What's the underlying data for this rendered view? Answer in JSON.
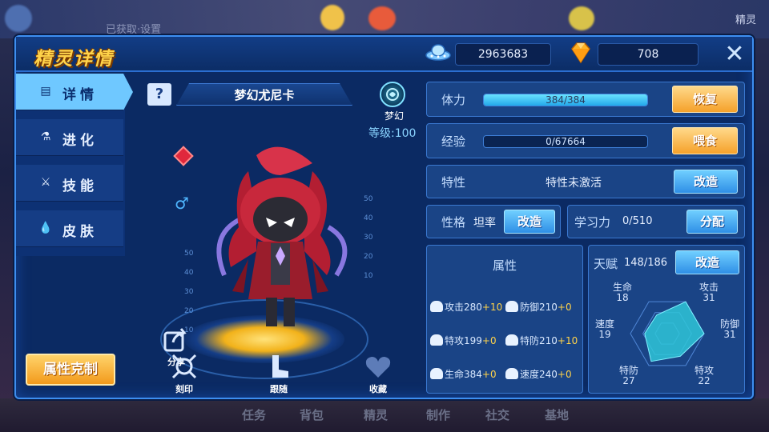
{
  "background": {
    "top_left_text": "已获取·设置",
    "top_right_text": "精灵",
    "bottom_nav": [
      "任务",
      "背包",
      "精灵",
      "制作",
      "社交",
      "基地"
    ]
  },
  "header": {
    "title": "精灵详情",
    "coins": "2963683",
    "gems": "708",
    "close_label": "✕"
  },
  "tabs": [
    {
      "label": "详情",
      "icon": "details-icon",
      "glyph": "▤"
    },
    {
      "label": "进化",
      "icon": "flask-icon",
      "glyph": "⚗"
    },
    {
      "label": "技能",
      "icon": "sword-icon",
      "glyph": "⚔"
    },
    {
      "label": "皮肤",
      "icon": "drop-icon",
      "glyph": "💧"
    }
  ],
  "attr_counter_button": "属性克制",
  "character": {
    "help": "?",
    "name": "梦幻尤尼卡",
    "type": "梦幻",
    "level": "等级:100",
    "gender": "♂",
    "scale_left": [
      "50",
      "40",
      "30",
      "20",
      "10"
    ],
    "scale_right": [
      "50",
      "40",
      "30",
      "20",
      "10"
    ],
    "share": "分享",
    "actions": [
      {
        "label": "刻印",
        "icon": "imprint-icon"
      },
      {
        "label": "跟随",
        "icon": "follow-icon"
      },
      {
        "label": "收藏",
        "icon": "heart-icon"
      }
    ]
  },
  "stats": {
    "hp_label": "体力",
    "hp_value": "384/384",
    "hp_fraction": 1.0,
    "hp_button": "恢复",
    "exp_label": "经验",
    "exp_value": "0/67664",
    "exp_fraction": 0.0,
    "exp_button": "喂食",
    "trait_label": "特性",
    "trait_value": "特性未激活",
    "trait_button": "改造",
    "nature_label": "性格",
    "nature_value": "坦率",
    "nature_button": "改造",
    "learn_label": "学习力",
    "learn_value": "0/510",
    "learn_button": "分配"
  },
  "attributes": {
    "title": "属性",
    "rows": [
      {
        "left_name": "攻击",
        "left_val": "280",
        "left_plus": "+10",
        "right_name": "防御",
        "right_val": "210",
        "right_plus": "+0"
      },
      {
        "left_name": "特攻",
        "left_val": "199",
        "left_plus": "+0",
        "right_name": "特防",
        "right_val": "210",
        "right_plus": "+10"
      },
      {
        "left_name": "生命",
        "left_val": "384",
        "left_plus": "+0",
        "right_name": "速度",
        "right_val": "240",
        "right_plus": "+0"
      }
    ]
  },
  "talent": {
    "label": "天赋",
    "value": "148/186",
    "button": "改造",
    "radar": [
      {
        "name": "攻击",
        "value": "31"
      },
      {
        "name": "防御",
        "value": "31"
      },
      {
        "name": "特攻",
        "value": "22"
      },
      {
        "name": "特防",
        "value": "27"
      },
      {
        "name": "速度",
        "value": "19"
      },
      {
        "name": "生命",
        "value": "18"
      }
    ],
    "max": 31
  },
  "colors": {
    "accent": "#3d8ef0",
    "title_gold": "#ffd34a",
    "bar_fill": "#23a8ea",
    "orange_button": "#f5a12a",
    "blue_button": "#2f8fe6",
    "radar_fill": "#2fc6d8"
  }
}
